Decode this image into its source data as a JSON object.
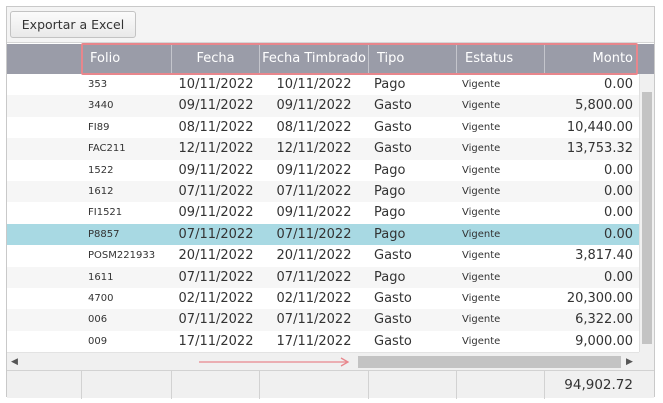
{
  "toolbar": {
    "export_label": "Exportar a Excel"
  },
  "columns": {
    "folio": "Folio",
    "fecha": "Fecha",
    "fecha_timbrado": "Fecha Timbrado",
    "tipo": "Tipo",
    "estatus": "Estatus",
    "monto": "Monto"
  },
  "rows": [
    {
      "folio": "353",
      "fecha": "10/11/2022",
      "fecha_timbrado": "10/11/2022",
      "tipo": "Pago",
      "estatus": "Vigente",
      "monto": "0.00"
    },
    {
      "folio": "3440",
      "fecha": "09/11/2022",
      "fecha_timbrado": "09/11/2022",
      "tipo": "Gasto",
      "estatus": "Vigente",
      "monto": "5,800.00"
    },
    {
      "folio": "FI89",
      "fecha": "08/11/2022",
      "fecha_timbrado": "08/11/2022",
      "tipo": "Gasto",
      "estatus": "Vigente",
      "monto": "10,440.00"
    },
    {
      "folio": "FAC211",
      "fecha": "12/11/2022",
      "fecha_timbrado": "12/11/2022",
      "tipo": "Gasto",
      "estatus": "Vigente",
      "monto": "13,753.32"
    },
    {
      "folio": "1522",
      "fecha": "09/11/2022",
      "fecha_timbrado": "09/11/2022",
      "tipo": "Pago",
      "estatus": "Vigente",
      "monto": "0.00"
    },
    {
      "folio": "1612",
      "fecha": "07/11/2022",
      "fecha_timbrado": "07/11/2022",
      "tipo": "Pago",
      "estatus": "Vigente",
      "monto": "0.00"
    },
    {
      "folio": "FI1521",
      "fecha": "09/11/2022",
      "fecha_timbrado": "09/11/2022",
      "tipo": "Pago",
      "estatus": "Vigente",
      "monto": "0.00"
    },
    {
      "folio": "P8857",
      "fecha": "07/11/2022",
      "fecha_timbrado": "07/11/2022",
      "tipo": "Pago",
      "estatus": "Vigente",
      "monto": "0.00",
      "selected": true
    },
    {
      "folio": "POSM221933",
      "fecha": "20/11/2022",
      "fecha_timbrado": "20/11/2022",
      "tipo": "Gasto",
      "estatus": "Vigente",
      "monto": "3,817.40"
    },
    {
      "folio": "1611",
      "fecha": "07/11/2022",
      "fecha_timbrado": "07/11/2022",
      "tipo": "Pago",
      "estatus": "Vigente",
      "monto": "0.00"
    },
    {
      "folio": "4700",
      "fecha": "02/11/2022",
      "fecha_timbrado": "02/11/2022",
      "tipo": "Gasto",
      "estatus": "Vigente",
      "monto": "20,300.00"
    },
    {
      "folio": "006",
      "fecha": "07/11/2022",
      "fecha_timbrado": "07/11/2022",
      "tipo": "Gasto",
      "estatus": "Vigente",
      "monto": "6,322.00"
    },
    {
      "folio": "009",
      "fecha": "17/11/2022",
      "fecha_timbrado": "17/11/2022",
      "tipo": "Gasto",
      "estatus": "Vigente",
      "monto": "9,000.00"
    }
  ],
  "footer": {
    "total": "94,902.72"
  },
  "colors": {
    "header_bg": "#9a9ca8",
    "selected_row": "#a8d9e3",
    "highlight_border": "#e8868c"
  }
}
